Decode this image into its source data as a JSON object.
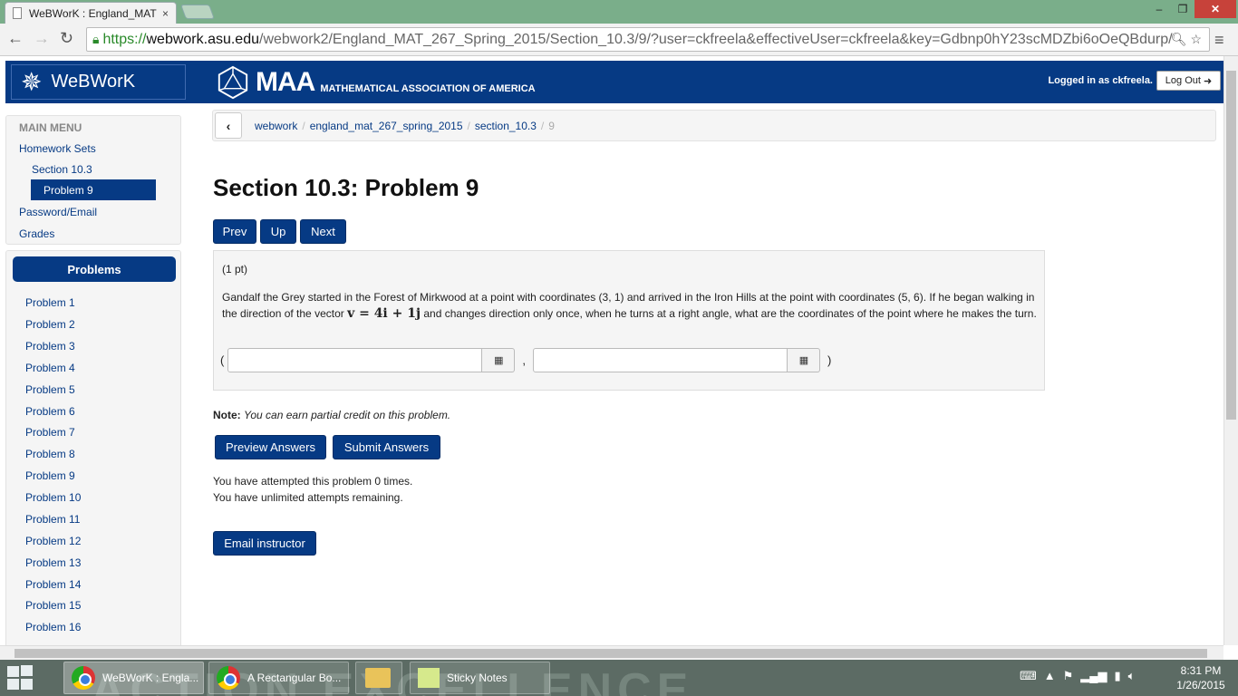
{
  "browser": {
    "tab_title": "WeBWorK : England_MAT",
    "tab_close": "×",
    "url_scheme": "https://",
    "url_host": "webwork.asu.edu",
    "url_path": "/webwork2/England_MAT_267_Spring_2015/Section_10.3/9/?user=ckfreela&effectiveUser=ckfreela&key=Gdbnp0hY23scMDZbi6oOeQBdurp/",
    "win_min": "–",
    "win_max": "❐",
    "win_close": "✕"
  },
  "header": {
    "logo_text": "WeBWorK",
    "maa_big": "MAA",
    "maa_small": "MATHEMATICAL ASSOCIATION OF AMERICA",
    "login_text": "Logged in as ckfreela.",
    "logout_label": "Log Out"
  },
  "main_menu": {
    "title": "MAIN MENU",
    "homework_sets": "Homework Sets",
    "section": "Section 10.3",
    "active": "Problem 9",
    "password_email": "Password/Email",
    "grades": "Grades"
  },
  "problems_panel": {
    "title": "Problems",
    "items": [
      "Problem 1",
      "Problem 2",
      "Problem 3",
      "Problem 4",
      "Problem 5",
      "Problem 6",
      "Problem 7",
      "Problem 8",
      "Problem 9",
      "Problem 10",
      "Problem 11",
      "Problem 12",
      "Problem 13",
      "Problem 14",
      "Problem 15",
      "Problem 16"
    ]
  },
  "breadcrumb": {
    "back": "‹",
    "crumb1": "webwork",
    "crumb2": "england_mat_267_spring_2015",
    "crumb3": "section_10.3",
    "current": "9",
    "sep": "/"
  },
  "page": {
    "title": "Section 10.3: Problem 9",
    "prev": "Prev",
    "up": "Up",
    "next": "Next"
  },
  "problem": {
    "points": "(1 pt)",
    "text_a": "Gandalf the Grey started in the Forest of Mirkwood at a point with coordinates (3, 1) and arrived in the Iron Hills at the point with coordinates (5, 6). If he began walking in the direction of the vector ",
    "math": "v = 4i + 1j",
    "text_b": " and changes direction only once, when he turns at a right angle, what are the coordinates of the point where he makes the turn.",
    "open_paren": "(",
    "comma": ",",
    "close_paren": ")",
    "answer1_value": "",
    "answer2_value": "",
    "palette_icon": "▦"
  },
  "note": {
    "label": "Note:",
    "text": "You can earn partial credit on this problem."
  },
  "actions": {
    "preview": "Preview Answers",
    "submit": "Submit Answers"
  },
  "attempts": {
    "line1": "You have attempted this problem 0 times.",
    "line2": "You have unlimited attempts remaining."
  },
  "email_button": "Email instructor",
  "taskbar": {
    "bg_text": "ACTION   EXCELLENCE",
    "items": [
      {
        "label": "WeBWorK : Engla..."
      },
      {
        "label": "A Rectangular Bo..."
      },
      {
        "label": "Sticky Notes"
      }
    ],
    "time": "8:31 PM",
    "date": "1/26/2015"
  }
}
